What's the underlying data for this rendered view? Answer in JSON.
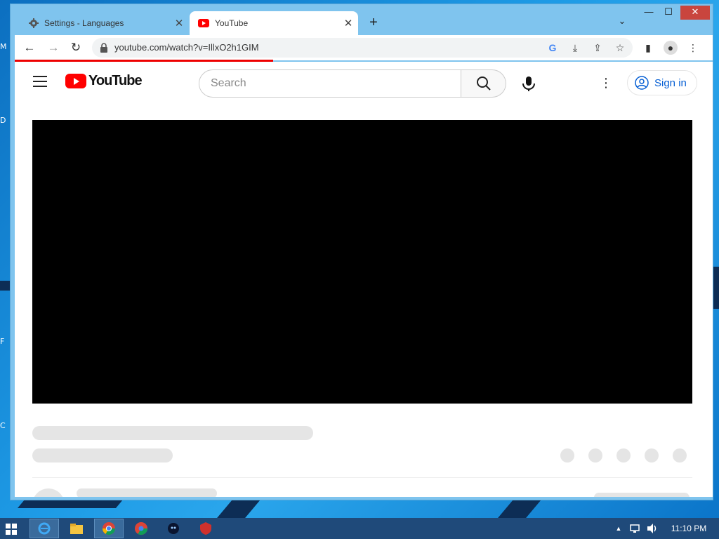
{
  "desktop": {
    "edge_labels": [
      "M",
      "D",
      "F",
      "C"
    ]
  },
  "window": {
    "tabs": [
      {
        "label": "Settings - Languages",
        "icon": "gear-icon",
        "close": "✕",
        "active": false
      },
      {
        "label": "YouTube",
        "icon": "youtube-icon",
        "close": "✕",
        "active": true
      }
    ],
    "new_tab": "+",
    "tab_search": "⌄",
    "controls": {
      "minimize": "—",
      "maximize": "☐",
      "close": "✕"
    }
  },
  "toolbar": {
    "back": "←",
    "forward": "→",
    "reload": "↻",
    "url": "youtube.com/watch?v=IllxO2h1GIM",
    "loading_progress": 0.37,
    "icons": [
      "google-icon",
      "install-icon",
      "share-icon",
      "bookmark-star-icon",
      "side-panel-icon",
      "profile-icon",
      "menu-kebab-icon"
    ]
  },
  "youtube": {
    "logo_text": "YouTube",
    "search_placeholder": "Search",
    "signin_label": "Sign in",
    "more": "⋮",
    "brand_color": "#ff0000",
    "link_color": "#065fd4"
  },
  "taskbar": {
    "apps": [
      {
        "name": "internet-explorer",
        "active": true
      },
      {
        "name": "file-explorer",
        "active": false
      },
      {
        "name": "chrome",
        "active": true
      },
      {
        "name": "chrome-profile-d",
        "active": false
      },
      {
        "name": "dark-circle-app",
        "active": false
      },
      {
        "name": "red-shield-app",
        "active": false
      }
    ],
    "tray_arrow": "▲",
    "clock": "11:10 PM"
  }
}
